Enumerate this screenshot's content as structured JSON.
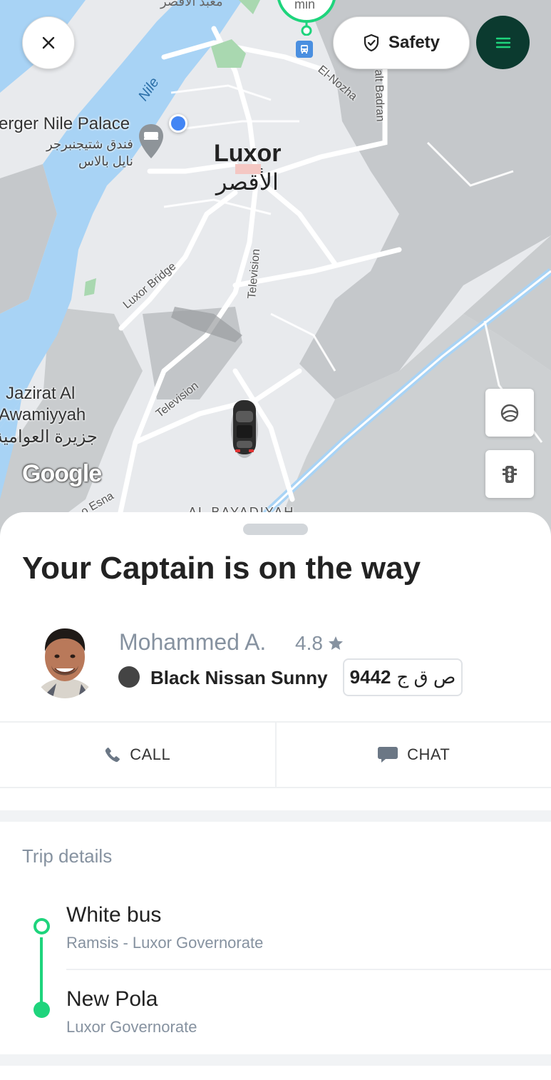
{
  "colors": {
    "accent_green": "#1ed47c",
    "menu_dark_green": "#0b3a2f",
    "map_water": "#a8d3f5",
    "map_land": "#e8eaed",
    "map_dark_land": "#bfc2c5",
    "user_location_blue": "#4285f4",
    "muted_text": "#8692a0"
  },
  "map": {
    "labels": {
      "top_arabic": "معبد الأقصر",
      "eta_unit": "min",
      "hotel_en": "erger Nile Palace",
      "hotel_ar_line1": "فندق شتيجنبرجر",
      "hotel_ar_line2": "نايل بالاس",
      "river": "Nile",
      "city_en": "Luxor",
      "city_ar": "الأقصر",
      "street_nozha": "El-Nozha",
      "street_badran": "alt Badran",
      "bridge": "Luxor Bridge",
      "road_television_1": "Television",
      "road_television_2": "Television",
      "island_line1": "Jazirat Al",
      "island_line2": "Awamiyyah",
      "island_ar": "جزيرة العوامية",
      "road_esna": "o Esna",
      "district_partial": "AL BAYADIYAH",
      "google_logo": "Google"
    },
    "icons": [
      "close-icon",
      "shield-check-icon",
      "menu-icon",
      "compass-icon",
      "traffic-light-icon",
      "hotel-bed-icon",
      "car-icon",
      "bus-stop-icon"
    ]
  },
  "header": {
    "safety_label": "Safety"
  },
  "sheet": {
    "title": "Your Captain is on the way",
    "driver": {
      "name": "Mohammed A.",
      "rating": "4.8",
      "car": "Black Nissan Sunny",
      "car_color": "#444444",
      "plate_number": "9442",
      "plate_letters": "ص ق ج"
    },
    "actions": {
      "call_label": "CALL",
      "chat_label": "CHAT"
    },
    "trip": {
      "heading": "Trip details",
      "pickup": {
        "title": "White bus",
        "subtitle": "Ramsis - Luxor Governorate"
      },
      "dropoff": {
        "title": "New Pola",
        "subtitle": "Luxor Governorate"
      }
    }
  }
}
